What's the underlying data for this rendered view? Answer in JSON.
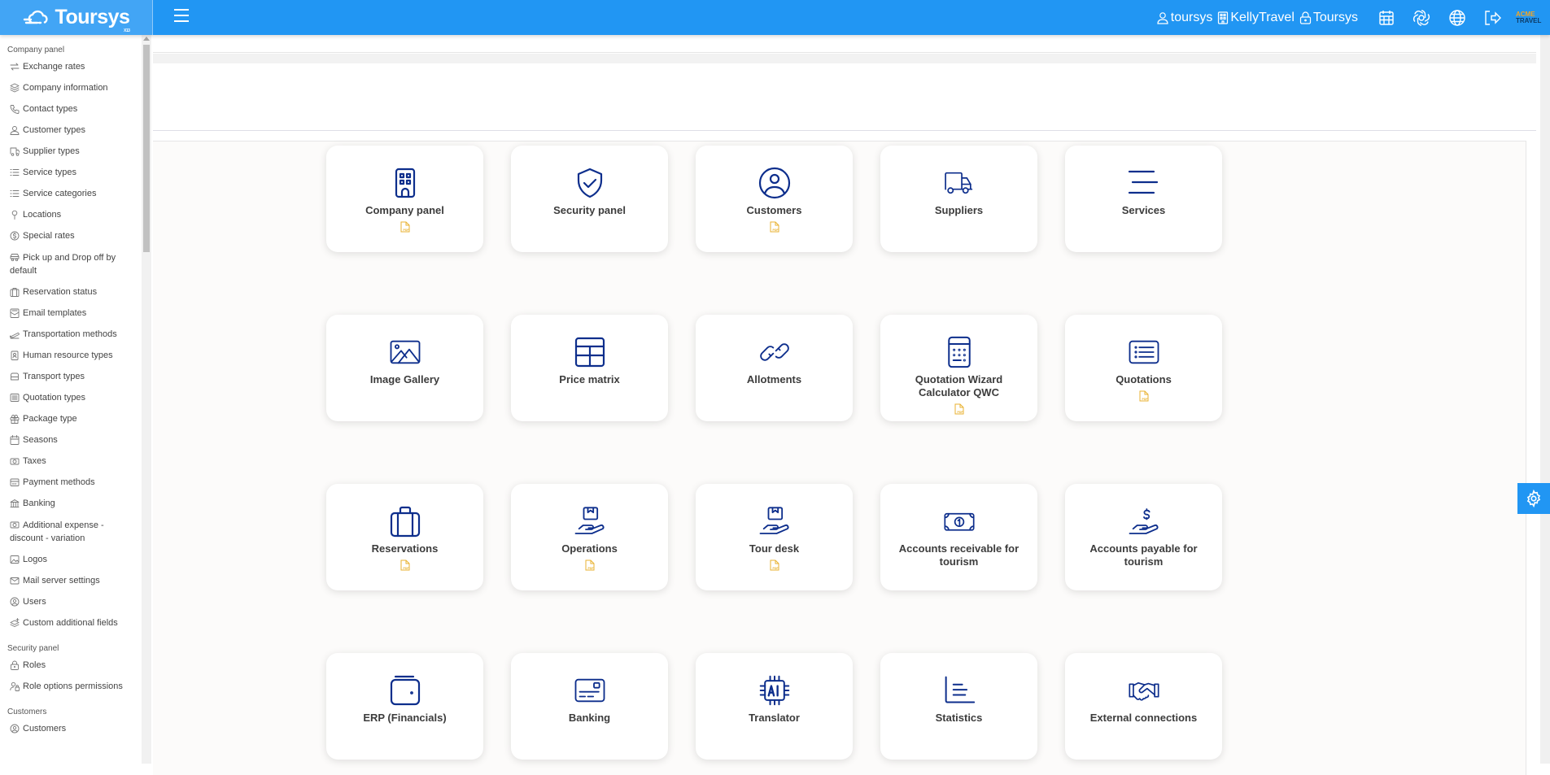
{
  "app": {
    "logo_text": "Toursys",
    "logo_sub": "X13",
    "menu_toggle": "menu-toggle"
  },
  "topbar": {
    "user": "toursys",
    "company": "KellyTravel",
    "role": "Toursys",
    "icons": [
      "calendar-icon",
      "openai-icon",
      "globe-icon",
      "logout-icon"
    ],
    "brand_logo_line1": "ACME",
    "brand_logo_line2": "TRAVEL"
  },
  "sidebar": {
    "sections": [
      {
        "title": "Company panel",
        "items": [
          {
            "label": "Exchange rates",
            "icon": "exchange-icon"
          },
          {
            "label": "Company information",
            "icon": "layers-icon"
          },
          {
            "label": "Contact types",
            "icon": "phone-icon"
          },
          {
            "label": "Customer types",
            "icon": "user-icon"
          },
          {
            "label": "Supplier types",
            "icon": "truck-icon"
          },
          {
            "label": "Service types",
            "icon": "list-icon"
          },
          {
            "label": "Service categories",
            "icon": "list-icon"
          },
          {
            "label": "Locations",
            "icon": "pin-icon"
          },
          {
            "label": "Special rates",
            "icon": "dollar-circle-icon"
          },
          {
            "label": "Pick up and Drop off by default",
            "icon": "car-icon"
          },
          {
            "label": "Reservation status",
            "icon": "suitcase-icon"
          },
          {
            "label": "Email templates",
            "icon": "mail-template-icon"
          },
          {
            "label": "Transportation methods",
            "icon": "plane-icon"
          },
          {
            "label": "Human resource types",
            "icon": "badge-icon"
          },
          {
            "label": "Transport types",
            "icon": "bus-icon"
          },
          {
            "label": "Quotation types",
            "icon": "list-box-icon"
          },
          {
            "label": "Package type",
            "icon": "gift-icon"
          },
          {
            "label": "Seasons",
            "icon": "calendar-icon"
          },
          {
            "label": "Taxes",
            "icon": "money-icon"
          },
          {
            "label": "Payment methods",
            "icon": "card-icon"
          },
          {
            "label": "Banking",
            "icon": "bank-icon"
          },
          {
            "label": "Additional expense - discount - variation",
            "icon": "money-icon"
          },
          {
            "label": "Logos",
            "icon": "image-icon"
          },
          {
            "label": "Mail server settings",
            "icon": "mail-icon"
          },
          {
            "label": "Users",
            "icon": "user-circle-icon"
          },
          {
            "label": "Custom additional fields",
            "icon": "layers-plus-icon"
          }
        ]
      },
      {
        "title": "Security panel",
        "items": [
          {
            "label": "Roles",
            "icon": "lock-icon"
          },
          {
            "label": "Role options permissions",
            "icon": "user-lock-icon"
          }
        ]
      },
      {
        "title": "Customers",
        "items": [
          {
            "label": "Customers",
            "icon": "user-circle-icon"
          }
        ]
      }
    ]
  },
  "cards": [
    {
      "label": "Company panel",
      "icon": "building-icon",
      "pdf": true
    },
    {
      "label": "Security panel",
      "icon": "shield-check-icon",
      "pdf": false
    },
    {
      "label": "Customers",
      "icon": "user-circle-icon",
      "pdf": true
    },
    {
      "label": "Suppliers",
      "icon": "truck-icon",
      "pdf": false
    },
    {
      "label": "Services",
      "icon": "menu-lines-icon",
      "pdf": false
    },
    {
      "label": "Image Gallery",
      "icon": "image-icon",
      "pdf": false
    },
    {
      "label": "Price matrix",
      "icon": "table-icon",
      "pdf": false
    },
    {
      "label": "Allotments",
      "icon": "link-icon",
      "pdf": false
    },
    {
      "label": "Quotation Wizard Calculator QWC",
      "icon": "calculator-icon",
      "pdf": true
    },
    {
      "label": "Quotations",
      "icon": "list-box-icon",
      "pdf": true
    },
    {
      "label": "Reservations",
      "icon": "suitcase-icon",
      "pdf": true
    },
    {
      "label": "Operations",
      "icon": "hand-box-icon",
      "pdf": true
    },
    {
      "label": "Tour desk",
      "icon": "hand-box-icon",
      "pdf": true
    },
    {
      "label": "Accounts receivable for tourism",
      "icon": "banknote-icon",
      "pdf": false
    },
    {
      "label": "Accounts payable for tourism",
      "icon": "hand-dollar-icon",
      "pdf": false
    },
    {
      "label": "ERP (Financials)",
      "icon": "wallet-icon",
      "pdf": false
    },
    {
      "label": "Banking",
      "icon": "credit-card-icon",
      "pdf": false
    },
    {
      "label": "Translator",
      "icon": "ai-chip-icon",
      "pdf": false
    },
    {
      "label": "Statistics",
      "icon": "chart-lines-icon",
      "pdf": false
    },
    {
      "label": "External connections",
      "icon": "handshake-icon",
      "pdf": false
    }
  ],
  "colors": {
    "primary": "#2196f3",
    "logo_bg": "#42a5f5",
    "icon": "#0d2e8c",
    "pdf": "#e8b230"
  },
  "settings_button": "settings-gear"
}
